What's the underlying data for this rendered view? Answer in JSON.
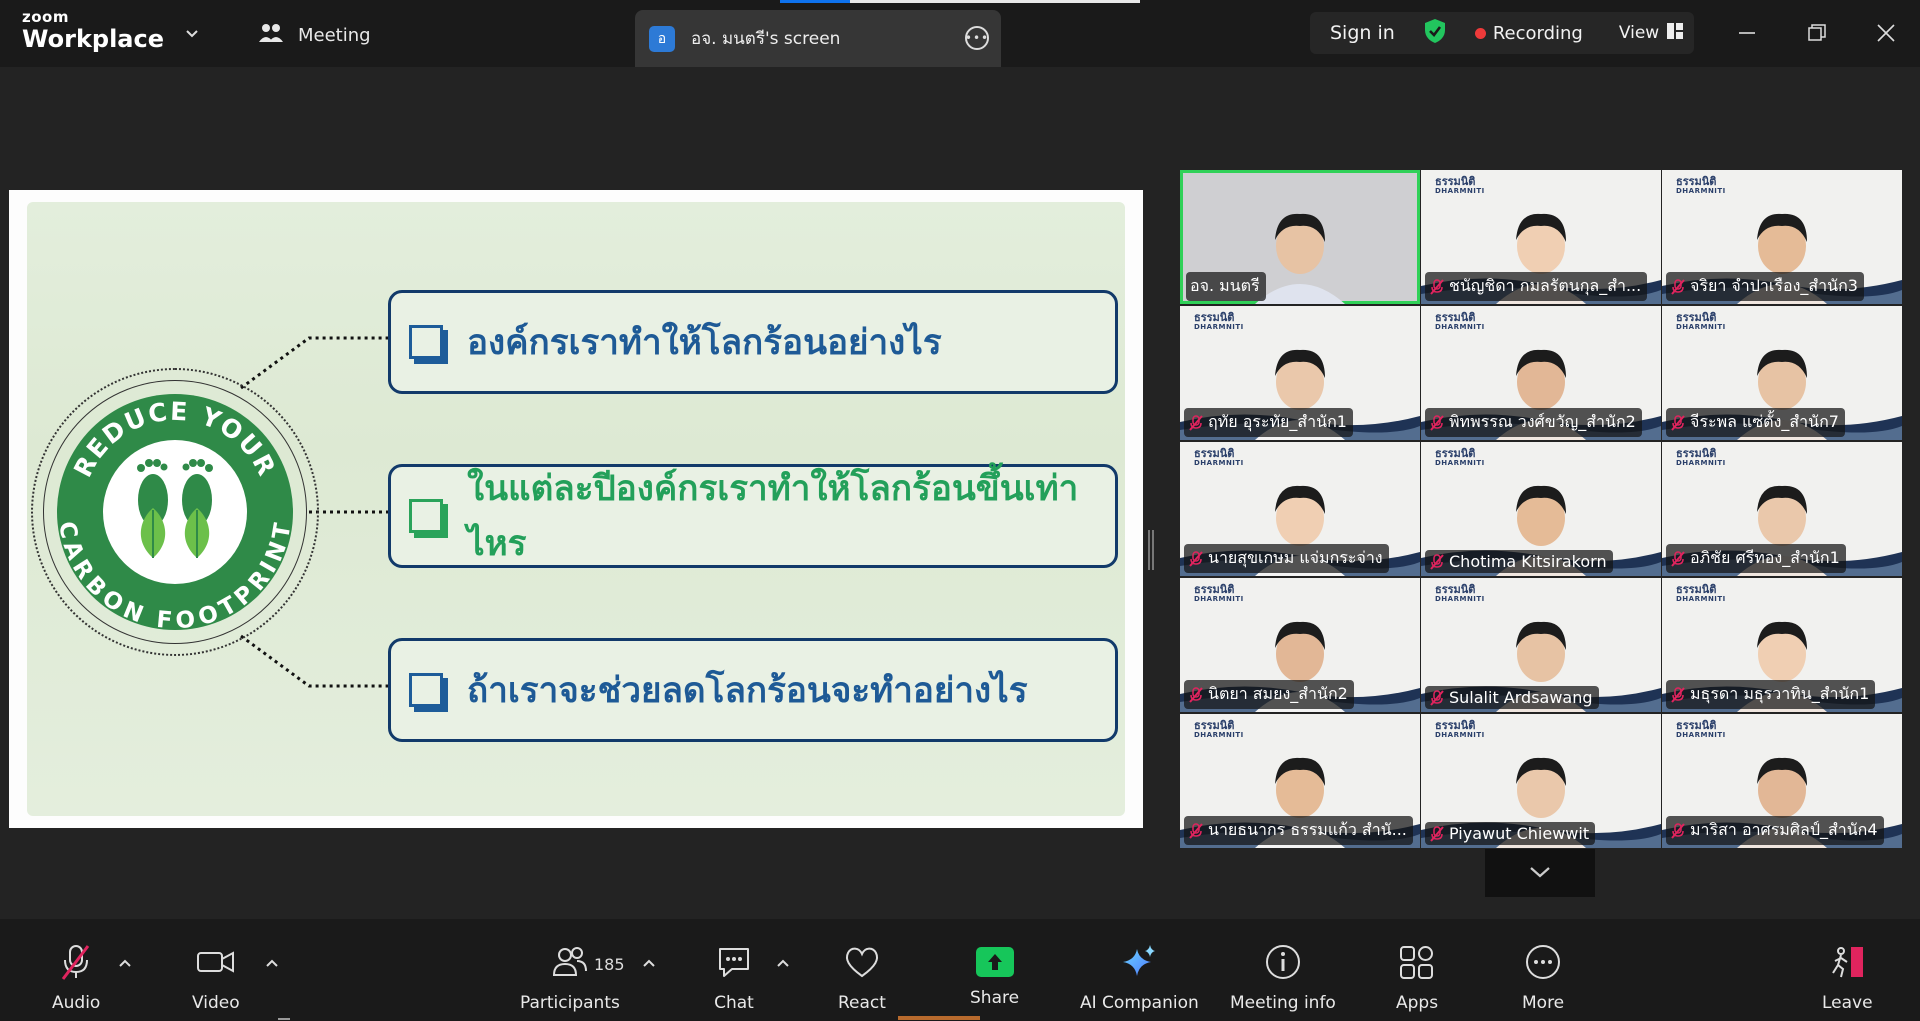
{
  "app": {
    "logo_small": "zoom",
    "logo_big": "Workplace",
    "meeting_menu_label": "Meeting",
    "screen_tab": {
      "avatar_letter": "อ",
      "label": "อจ. มนตรี's screen"
    },
    "sign_in": "Sign in",
    "recording_label": "Recording",
    "view_label": "View",
    "colors": {
      "accent": "#0e72ed",
      "recording": "#ee3a3a",
      "active_speaker": "#30d158",
      "share": "#16c65a"
    }
  },
  "slide": {
    "badge_top": "REDUCE YOUR",
    "badge_bottom": "CARBON FOOTPRINT",
    "questions": [
      {
        "text": "องค์กรเราทำให้โลกร้อนอย่างไร",
        "color": "#1e5a96"
      },
      {
        "text": "ในแต่ละปีองค์กรเราทำให้โลกร้อนขึ้นเท่าไหร",
        "color": "#23a05a"
      },
      {
        "text": "ถ้าเราจะช่วยลดโลกร้อนจะทำอย่างไร",
        "color": "#1e5a96"
      }
    ]
  },
  "gallery": {
    "brand_th": "ธรรมนิติ",
    "brand_en": "DHARMNITI",
    "tiles": [
      {
        "name": "อจ. มนตรี",
        "muted": false,
        "active": true
      },
      {
        "name": "ชนัญชิดา กมลรัตนกุล_สำ...",
        "muted": true,
        "active": false
      },
      {
        "name": "จริยา จำปาเรือง_สำนัก3",
        "muted": true,
        "active": false
      },
      {
        "name": "ฤทัย อุระทัย_สำนัก1",
        "muted": true,
        "active": false
      },
      {
        "name": "พิทพรรณ วงศ์ขวัญ_สำนัก2",
        "muted": true,
        "active": false
      },
      {
        "name": "จีระพล แซ่ตั้ง_สำนัก7",
        "muted": true,
        "active": false
      },
      {
        "name": "นายสุขเกษม  แจ่มกระจ่าง",
        "muted": true,
        "active": false
      },
      {
        "name": "Chotima Kitsirakorn",
        "muted": true,
        "active": false
      },
      {
        "name": "อภิชัย ศรีทอง_สำนัก1",
        "muted": true,
        "active": false
      },
      {
        "name": "นิตยา สมยง_สำนัก2",
        "muted": true,
        "active": false
      },
      {
        "name": "Sulalit Ardsawang",
        "muted": true,
        "active": false
      },
      {
        "name": "มธุรดา มธุรวาทิน_สำนัก1",
        "muted": true,
        "active": false
      },
      {
        "name": "นายธนากร ธรรมแก้ว สำนั...",
        "muted": true,
        "active": false
      },
      {
        "name": "Piyawut Chiewwit",
        "muted": true,
        "active": false
      },
      {
        "name": "มาริสา อาศรมศิลป์_สำนัก4",
        "muted": true,
        "active": false
      }
    ]
  },
  "toolbar": {
    "audio": "Audio",
    "video": "Video",
    "participants": "Participants",
    "participants_count": "185",
    "chat": "Chat",
    "react": "React",
    "share": "Share",
    "ai_companion": "AI Companion",
    "meeting_info": "Meeting info",
    "apps": "Apps",
    "more": "More",
    "leave": "Leave"
  }
}
